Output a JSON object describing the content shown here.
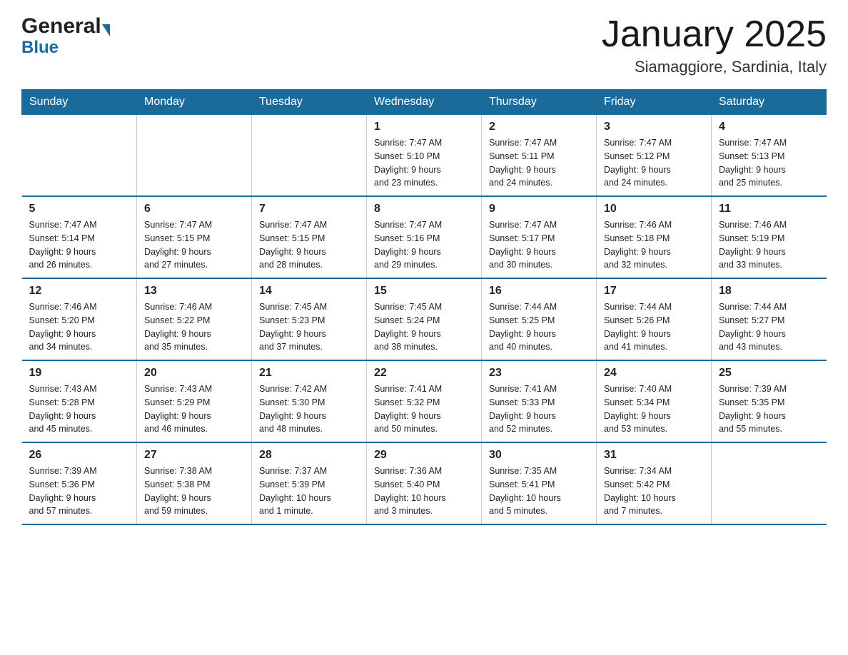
{
  "header": {
    "logo_general": "General",
    "logo_blue": "Blue",
    "month_title": "January 2025",
    "location": "Siamaggiore, Sardinia, Italy"
  },
  "days_of_week": [
    "Sunday",
    "Monday",
    "Tuesday",
    "Wednesday",
    "Thursday",
    "Friday",
    "Saturday"
  ],
  "weeks": [
    [
      {
        "day": "",
        "info": ""
      },
      {
        "day": "",
        "info": ""
      },
      {
        "day": "",
        "info": ""
      },
      {
        "day": "1",
        "info": "Sunrise: 7:47 AM\nSunset: 5:10 PM\nDaylight: 9 hours\nand 23 minutes."
      },
      {
        "day": "2",
        "info": "Sunrise: 7:47 AM\nSunset: 5:11 PM\nDaylight: 9 hours\nand 24 minutes."
      },
      {
        "day": "3",
        "info": "Sunrise: 7:47 AM\nSunset: 5:12 PM\nDaylight: 9 hours\nand 24 minutes."
      },
      {
        "day": "4",
        "info": "Sunrise: 7:47 AM\nSunset: 5:13 PM\nDaylight: 9 hours\nand 25 minutes."
      }
    ],
    [
      {
        "day": "5",
        "info": "Sunrise: 7:47 AM\nSunset: 5:14 PM\nDaylight: 9 hours\nand 26 minutes."
      },
      {
        "day": "6",
        "info": "Sunrise: 7:47 AM\nSunset: 5:15 PM\nDaylight: 9 hours\nand 27 minutes."
      },
      {
        "day": "7",
        "info": "Sunrise: 7:47 AM\nSunset: 5:15 PM\nDaylight: 9 hours\nand 28 minutes."
      },
      {
        "day": "8",
        "info": "Sunrise: 7:47 AM\nSunset: 5:16 PM\nDaylight: 9 hours\nand 29 minutes."
      },
      {
        "day": "9",
        "info": "Sunrise: 7:47 AM\nSunset: 5:17 PM\nDaylight: 9 hours\nand 30 minutes."
      },
      {
        "day": "10",
        "info": "Sunrise: 7:46 AM\nSunset: 5:18 PM\nDaylight: 9 hours\nand 32 minutes."
      },
      {
        "day": "11",
        "info": "Sunrise: 7:46 AM\nSunset: 5:19 PM\nDaylight: 9 hours\nand 33 minutes."
      }
    ],
    [
      {
        "day": "12",
        "info": "Sunrise: 7:46 AM\nSunset: 5:20 PM\nDaylight: 9 hours\nand 34 minutes."
      },
      {
        "day": "13",
        "info": "Sunrise: 7:46 AM\nSunset: 5:22 PM\nDaylight: 9 hours\nand 35 minutes."
      },
      {
        "day": "14",
        "info": "Sunrise: 7:45 AM\nSunset: 5:23 PM\nDaylight: 9 hours\nand 37 minutes."
      },
      {
        "day": "15",
        "info": "Sunrise: 7:45 AM\nSunset: 5:24 PM\nDaylight: 9 hours\nand 38 minutes."
      },
      {
        "day": "16",
        "info": "Sunrise: 7:44 AM\nSunset: 5:25 PM\nDaylight: 9 hours\nand 40 minutes."
      },
      {
        "day": "17",
        "info": "Sunrise: 7:44 AM\nSunset: 5:26 PM\nDaylight: 9 hours\nand 41 minutes."
      },
      {
        "day": "18",
        "info": "Sunrise: 7:44 AM\nSunset: 5:27 PM\nDaylight: 9 hours\nand 43 minutes."
      }
    ],
    [
      {
        "day": "19",
        "info": "Sunrise: 7:43 AM\nSunset: 5:28 PM\nDaylight: 9 hours\nand 45 minutes."
      },
      {
        "day": "20",
        "info": "Sunrise: 7:43 AM\nSunset: 5:29 PM\nDaylight: 9 hours\nand 46 minutes."
      },
      {
        "day": "21",
        "info": "Sunrise: 7:42 AM\nSunset: 5:30 PM\nDaylight: 9 hours\nand 48 minutes."
      },
      {
        "day": "22",
        "info": "Sunrise: 7:41 AM\nSunset: 5:32 PM\nDaylight: 9 hours\nand 50 minutes."
      },
      {
        "day": "23",
        "info": "Sunrise: 7:41 AM\nSunset: 5:33 PM\nDaylight: 9 hours\nand 52 minutes."
      },
      {
        "day": "24",
        "info": "Sunrise: 7:40 AM\nSunset: 5:34 PM\nDaylight: 9 hours\nand 53 minutes."
      },
      {
        "day": "25",
        "info": "Sunrise: 7:39 AM\nSunset: 5:35 PM\nDaylight: 9 hours\nand 55 minutes."
      }
    ],
    [
      {
        "day": "26",
        "info": "Sunrise: 7:39 AM\nSunset: 5:36 PM\nDaylight: 9 hours\nand 57 minutes."
      },
      {
        "day": "27",
        "info": "Sunrise: 7:38 AM\nSunset: 5:38 PM\nDaylight: 9 hours\nand 59 minutes."
      },
      {
        "day": "28",
        "info": "Sunrise: 7:37 AM\nSunset: 5:39 PM\nDaylight: 10 hours\nand 1 minute."
      },
      {
        "day": "29",
        "info": "Sunrise: 7:36 AM\nSunset: 5:40 PM\nDaylight: 10 hours\nand 3 minutes."
      },
      {
        "day": "30",
        "info": "Sunrise: 7:35 AM\nSunset: 5:41 PM\nDaylight: 10 hours\nand 5 minutes."
      },
      {
        "day": "31",
        "info": "Sunrise: 7:34 AM\nSunset: 5:42 PM\nDaylight: 10 hours\nand 7 minutes."
      },
      {
        "day": "",
        "info": ""
      }
    ]
  ]
}
